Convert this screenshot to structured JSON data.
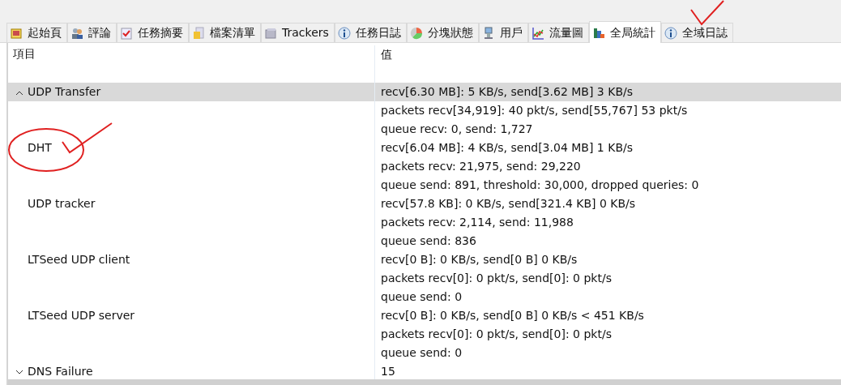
{
  "tabs": [
    {
      "label": "起始頁",
      "selected": false
    },
    {
      "label": "評論",
      "selected": false
    },
    {
      "label": "任務摘要",
      "selected": false
    },
    {
      "label": "檔案清單",
      "selected": false
    },
    {
      "label": "Trackers",
      "selected": false
    },
    {
      "label": "任務日誌",
      "selected": false
    },
    {
      "label": "分塊狀態",
      "selected": false
    },
    {
      "label": "用戶",
      "selected": false
    },
    {
      "label": "流量圖",
      "selected": false
    },
    {
      "label": "全局統計",
      "selected": true
    },
    {
      "label": "全域日誌",
      "selected": false
    }
  ],
  "table": {
    "columns": [
      "項目",
      "值"
    ],
    "rows": [
      {
        "label": "UDP Transfer",
        "expanded": true,
        "selected": true,
        "lines": [
          "recv[6.30 MB]: 5 KB/s, send[3.62 MB] 3 KB/s",
          "packets recv[34,919]: 40 pkt/s, send[55,767] 53 pkt/s",
          "queue recv: 0, send: 1,727"
        ],
        "children": [
          {
            "label": "DHT",
            "lines": [
              "recv[6.04 MB]: 4 KB/s, send[3.04 MB] 1 KB/s",
              "packets recv: 21,975, send: 29,220",
              "queue send: 891, threshold: 30,000, dropped queries: 0"
            ]
          },
          {
            "label": "UDP tracker",
            "lines": [
              "recv[57.8 KB]: 0 KB/s, send[321.4 KB] 0 KB/s",
              "packets recv: 2,114, send: 11,988",
              "queue send: 836"
            ]
          },
          {
            "label": "LTSeed UDP client",
            "lines": [
              "recv[0 B]: 0 KB/s, send[0 B] 0 KB/s",
              "packets recv[0]: 0 pkt/s, send[0]: 0 pkt/s",
              "queue send: 0"
            ]
          },
          {
            "label": "LTSeed UDP server",
            "lines": [
              "recv[0 B]: 0 KB/s, send[0 B] 0 KB/s < 451 KB/s",
              "packets recv[0]: 0 pkt/s, send[0]: 0 pkt/s",
              "queue send: 0"
            ]
          }
        ]
      },
      {
        "label": "DNS Failure",
        "expanded": false,
        "selected": false,
        "lines": [
          "15"
        ]
      }
    ]
  }
}
